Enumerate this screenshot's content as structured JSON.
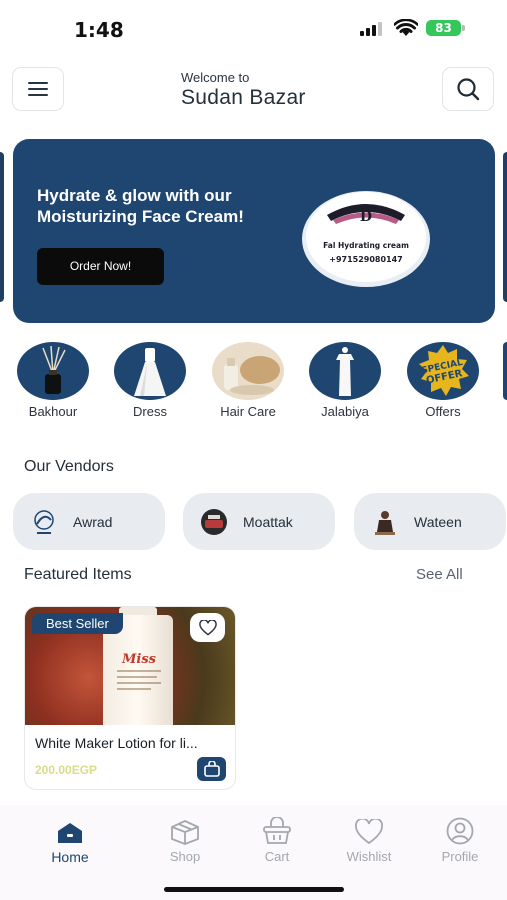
{
  "status_bar": {
    "time": "1:48",
    "battery": "83",
    "icons": [
      "signal-icon",
      "wifi-icon",
      "battery-icon"
    ]
  },
  "header": {
    "welcome": "Welcome to",
    "brand": "Sudan Bazar",
    "icons": [
      "menu-icon",
      "search-icon"
    ]
  },
  "banner": {
    "headline": "Hydrate & glow with our Moisturizing Face Cream!",
    "button_label": "Order Now!",
    "product_text": "Fal Hydrating cream",
    "phone": "+971529080147"
  },
  "categories": [
    {
      "label": "Bakhour"
    },
    {
      "label": "Dress"
    },
    {
      "label": "Hair Care"
    },
    {
      "label": "Jalabiya"
    },
    {
      "label": "Offers",
      "image_text": "SPECIAL OFFER"
    }
  ],
  "vendors": {
    "title": "Our Vendors",
    "items": [
      {
        "name": "Awrad"
      },
      {
        "name": "Moattak"
      },
      {
        "name": "Wateen"
      }
    ]
  },
  "featured": {
    "title": "Featured Items",
    "see_all": "See All",
    "items": [
      {
        "badge": "Best Seller",
        "name": "White Maker Lotion for li...",
        "price": "200.00EGP",
        "label_text": "Miss"
      }
    ]
  },
  "nav": {
    "items": [
      {
        "label": "Home",
        "icon": "home-icon",
        "active": true
      },
      {
        "label": "Shop",
        "icon": "box-icon",
        "active": false
      },
      {
        "label": "Cart",
        "icon": "basket-icon",
        "active": false
      },
      {
        "label": "Wishlist",
        "icon": "heart-icon",
        "active": false
      },
      {
        "label": "Profile",
        "icon": "user-circle-icon",
        "active": false
      }
    ]
  },
  "colors": {
    "primary": "#1f4670",
    "price": "#d7dd8a",
    "active_nav": "#1f4670",
    "inactive_nav": "#a3a8ae",
    "pill_bg": "#e8ecf0"
  }
}
